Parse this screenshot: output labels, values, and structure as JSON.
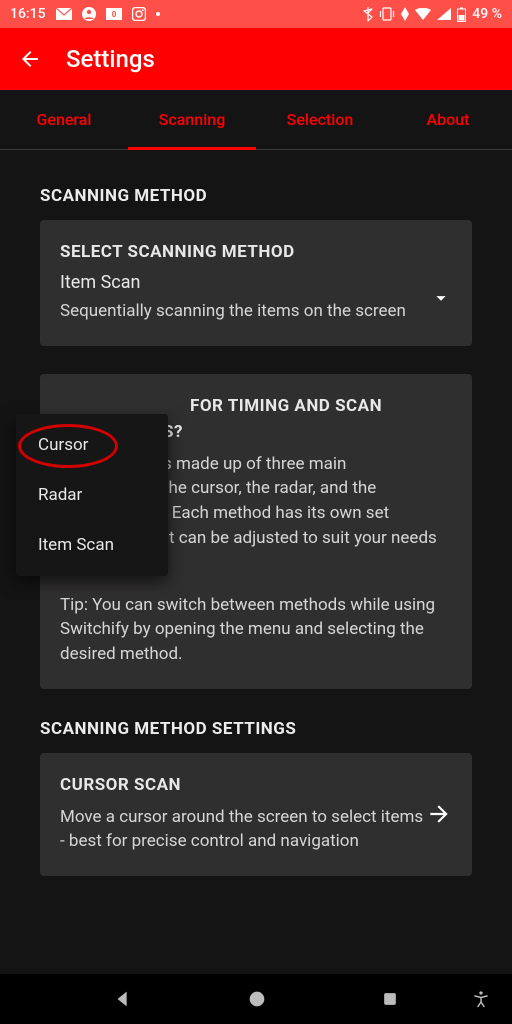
{
  "status": {
    "time": "16:15",
    "battery": "49 %"
  },
  "header": {
    "title": "Settings"
  },
  "tabs": [
    {
      "label": "General"
    },
    {
      "label": "Scanning",
      "active": true
    },
    {
      "label": "Selection"
    },
    {
      "label": "About"
    }
  ],
  "sections": {
    "scanning_method_title": "SCANNING METHOD",
    "select_method": {
      "title": "SELECT SCANNING METHOD",
      "value": "Item Scan",
      "description": "Sequentially scanning the items on the screen",
      "options": [
        "Cursor",
        "Radar",
        "Item Scan"
      ]
    },
    "looking_card": {
      "title_fragment": "FOR TIMING AND SCAN",
      "title_suffix": "S?",
      "body_fragment1": "s made up of three main",
      "body_fragment2": "the cursor, the radar, and the",
      "body_fragment3": ". Each method has its own set",
      "body_line2": "of settings that can be adjusted to suit your needs below.",
      "tip": "Tip: You can switch between methods while using Switchify by opening the menu and selecting the desired method."
    },
    "settings_title": "SCANNING METHOD SETTINGS",
    "cursor_scan": {
      "title": "CURSOR SCAN",
      "description": "Move a cursor around the screen to select items - best for precise control and navigation"
    }
  }
}
